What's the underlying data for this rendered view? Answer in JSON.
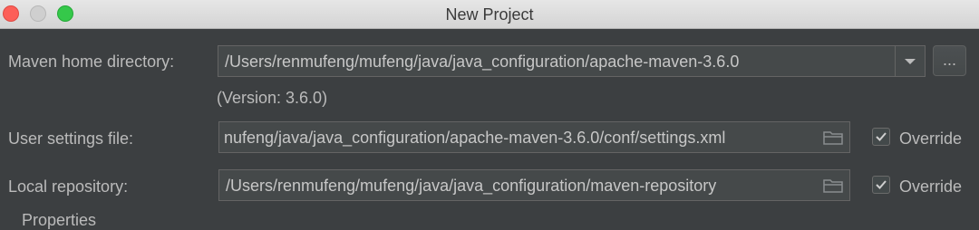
{
  "window": {
    "title": "New Project"
  },
  "maven_home": {
    "label": "Maven home directory:",
    "value": "/Users/renmufeng/mufeng/java/java_configuration/apache-maven-3.6.0",
    "browse_label": "...",
    "version_text": "(Version: 3.6.0)"
  },
  "user_settings": {
    "label": "User settings file:",
    "value": "nufeng/java/java_configuration/apache-maven-3.6.0/conf/settings.xml",
    "override_label": "Override",
    "override_checked": true
  },
  "local_repository": {
    "label": "Local repository:",
    "value": "/Users/renmufeng/mufeng/java/java_configuration/maven-repository",
    "override_label": "Override",
    "override_checked": true
  },
  "next_section": {
    "label": "Properties"
  },
  "icons": {
    "close": "close-traffic-light",
    "minimize": "minimize-traffic-light",
    "maximize": "maximize-traffic-light",
    "dropdown": "chevron-down-icon",
    "folder": "folder-icon",
    "check": "checkmark-icon"
  },
  "colors": {
    "background": "#3c3f41",
    "field_background": "#45494a",
    "text": "#bbbbbb",
    "close": "#fc5f58",
    "maximize": "#35c84a"
  }
}
